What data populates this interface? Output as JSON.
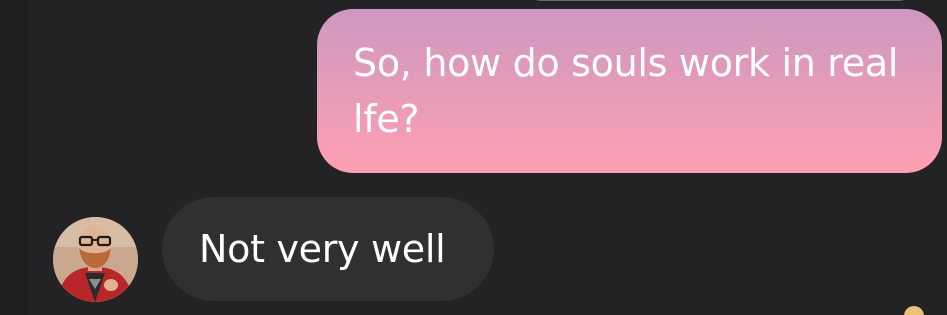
{
  "conversation": {
    "messages": [
      {
        "direction": "outgoing",
        "text": "So, how do souls work in real lfe?"
      },
      {
        "direction": "incoming",
        "text": "Not very well"
      }
    ]
  },
  "colors": {
    "background": "#232325",
    "outgoing_gradient_top": "#cd98c0",
    "outgoing_gradient_bottom": "#ff9fb1",
    "incoming_bubble": "#303032",
    "text": "#ffffff"
  },
  "icons": {
    "avatar": "user-avatar-photo",
    "corner_indicator": "reaction-icon"
  }
}
